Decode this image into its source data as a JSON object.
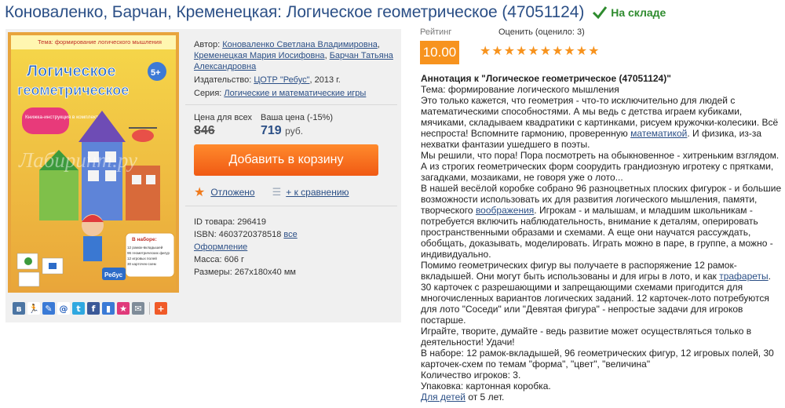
{
  "header": {
    "title": "Коноваленко, Барчан, Кременецкая: Логическое геометрическое (47051124)",
    "stock_label": "На складе"
  },
  "cover": {
    "theme_text": "Тема: формирование логического мышления",
    "title_line1": "Логическое",
    "title_line2": "геометрическое",
    "age_badge": "5+",
    "booklet_note": "Книжка-инструкция в комплекте!",
    "watermark": "Лабиринт.ру",
    "set_heading": "В наборе:",
    "set_lines": [
      "12 рамок-вкладышей",
      "96 геометрических фигур",
      "12 игровых полей",
      "30 карточек-схем"
    ],
    "publisher_logo": "Ребус"
  },
  "share_icons": [
    "vk-icon",
    "odnoklassniki-icon",
    "livejournal-icon",
    "mail-icon",
    "twitter-icon",
    "facebook-icon",
    "bookmark-icon",
    "favorite-icon",
    "print-icon",
    "plus-icon"
  ],
  "details": {
    "author_label": "Автор:",
    "authors": [
      "Коноваленко Светлана Владимировна",
      "Кременецкая Мария Иосифовна",
      "Барчан Татьяна Александровна"
    ],
    "publisher_label": "Издательство:",
    "publisher": "ЦОТР \"Ребус\"",
    "year": ", 2013 г.",
    "series_label": "Серия:",
    "series": "Логические и математические игры"
  },
  "price": {
    "everyone_label": "Цена для всех",
    "old_price": "846",
    "your_label": "Ваша цена (-15%)",
    "new_price": "719",
    "currency": "руб."
  },
  "cart_button": "Добавить в корзину",
  "actions": {
    "postpone": "Отложено",
    "compare": "+ к сравнению"
  },
  "meta": {
    "id_label": "ID товара:",
    "id_value": "296419",
    "isbn_label": "ISBN:",
    "isbn_value": "4603720378518",
    "all_link": "все",
    "design_link": "Оформление",
    "mass_label": "Масса:",
    "mass_value": "606 г",
    "size_label": "Размеры:",
    "size_value": "267x180x40 мм"
  },
  "rating": {
    "label": "Рейтинг",
    "value": "10.00",
    "rate_label": "Оценить (оценило: 3)",
    "stars_filled": 10
  },
  "annotation": {
    "title": "Аннотация к \"Логическое геометрическое (47051124)\"",
    "theme": "Тема: формирование логического мышления",
    "p1_a": "Это только кажется, что геометрия - что-то исключительно для людей с математическими способностями. А мы ведь с детства играем кубиками, мячиками, складываем квадратики с картинками, рисуем кружочки-колесики. Всё неспроста! Вспомните гармонию, проверенную ",
    "p1_link": "математикой",
    "p1_b": ". И физика, из-за нехватки фантазии ушедшего в поэты.",
    "p2": "Мы решили, что пора! Пора посмотреть на обыкновенное - хитреньким взглядом. А из строгих геометрических форм соорудить грандиозную игротеку с прятками, загадками, мозаиками, не говоря уже о лото...",
    "p3_a": "В нашей весёлой коробке собрано 96 разноцветных плоских фигурок - и большие возможности использовать их для развития логического мышления, памяти, творческого ",
    "p3_link": "воображения",
    "p3_b": ". Игрокам - и малышам, и младшим школьникам - потребуется включить наблюдательность, внимание к деталям, оперировать пространственными образами и схемами. А еще они научатся рассуждать, обобщать, доказывать, моделировать. Играть можно в паре, в группе, а можно - индивидуально.",
    "p4_a": "Помимо геометрических фигур вы получаете в распоряжение 12 рамок-вкладышей. Они могут быть использованы и для игры в лото, и как ",
    "p4_link": "трафареты",
    "p4_b": ". 30 карточек с разрешающими и запрещающими схемами пригодится для многочисленных вариантов логических заданий. 12 карточек-лото потребуются для лото \"Соседи\" или \"Девятая фигура\" - непростые задачи для игроков постарше.",
    "p5": "Играйте, творите, думайте - ведь развитие может осуществляться только в деятельности! Удачи!",
    "p6": "В наборе: 12 рамок-вкладышей, 96 геометрических фигур, 12 игровых полей, 30 карточек-схем по темам \"форма\", \"цвет\", \"величина\"",
    "p7": "Количество игроков: 3.",
    "p8": "Упаковка: картонная коробка.",
    "p9_link": "Для детей",
    "p9_b": " от 5 лет."
  },
  "colors": {
    "link": "#2b4f86",
    "accent_orange": "#f7931e",
    "stock_green": "#2e8b2e"
  }
}
